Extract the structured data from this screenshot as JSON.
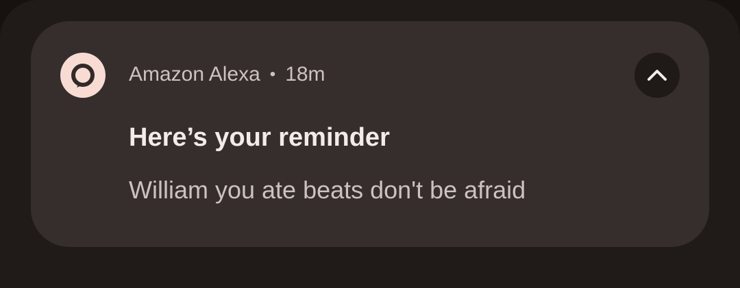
{
  "notification": {
    "app_name": "Amazon Alexa",
    "separator": "•",
    "time": "18m",
    "title": "Here’s your reminder",
    "text": "William you ate beats don't be afraid",
    "app_icon": "alexa-ring-icon",
    "expand_icon": "chevron-up-icon"
  },
  "colors": {
    "background": "#171210",
    "shade": "#201b19",
    "card": "#352e2d",
    "icon_badge": "#f8dcd4",
    "icon_glyph": "#332a28",
    "title_text": "#f3ebe9",
    "secondary_text": "#cdc2bf",
    "button_bg": "#1f1918"
  }
}
